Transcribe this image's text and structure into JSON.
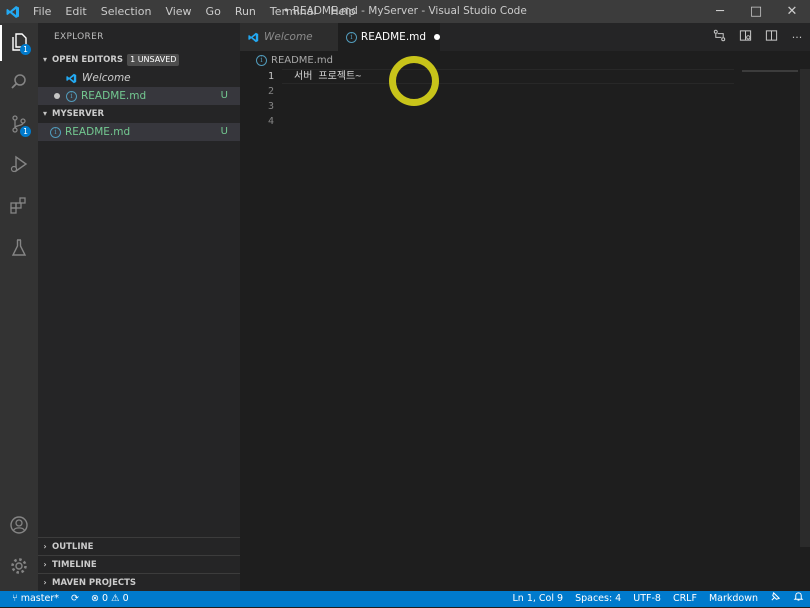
{
  "titlebar": {
    "menu": [
      "File",
      "Edit",
      "Selection",
      "View",
      "Go",
      "Run",
      "Terminal",
      "Help"
    ],
    "window_title": "• README.md - MyServer - Visual Studio Code",
    "minimize": "─",
    "maximize": "□",
    "close": "✕"
  },
  "activitybar": {
    "explorer_badge": "1",
    "scm_badge": "1"
  },
  "sidebar": {
    "title": "EXPLORER",
    "open_editors": {
      "label": "OPEN EDITORS",
      "badge": "1 UNSAVED",
      "items": [
        {
          "label": "Welcome"
        },
        {
          "label": "README.md",
          "status": "U"
        }
      ]
    },
    "folder": {
      "label": "MYSERVER",
      "items": [
        {
          "label": "README.md",
          "status": "U"
        }
      ]
    },
    "bottom_sections": [
      "OUTLINE",
      "TIMELINE",
      "MAVEN PROJECTS"
    ]
  },
  "tabs": [
    {
      "label": "Welcome"
    },
    {
      "label": "README.md"
    }
  ],
  "breadcrumb": "README.md",
  "editor": {
    "lines": [
      {
        "number": "1",
        "text": "서버 프로젝트~"
      },
      {
        "number": "2",
        "text": ""
      },
      {
        "number": "3",
        "text": ""
      },
      {
        "number": "4",
        "text": ""
      }
    ]
  },
  "statusbar": {
    "branch": "master*",
    "errors": "0",
    "warnings": "0",
    "position": "Ln 1, Col 9",
    "spaces": "Spaces: 4",
    "encoding": "UTF-8",
    "eol": "CRLF",
    "language": "Markdown"
  },
  "colors": {
    "accent": "#007acc",
    "git_untracked": "#73c991",
    "cursor_ring": "#c8c41a"
  }
}
